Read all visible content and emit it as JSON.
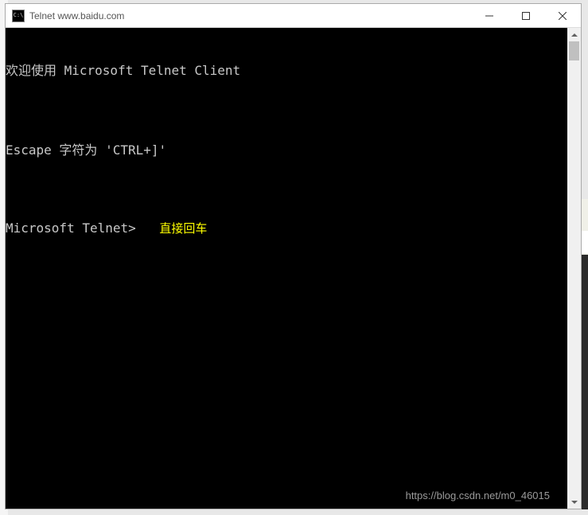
{
  "window": {
    "title": "Telnet www.baidu.com",
    "icon_label": "C:\\"
  },
  "terminal": {
    "line1": "欢迎使用 Microsoft Telnet Client",
    "line2": "",
    "line3": "Escape 字符为 'CTRL+]'",
    "prompt": "Microsoft Telnet> ",
    "annotation": "直接回车"
  },
  "watermark": "https://blog.csdn.net/m0_46015",
  "controls": {
    "minimize": "Minimize",
    "maximize": "Maximize",
    "close": "Close"
  }
}
